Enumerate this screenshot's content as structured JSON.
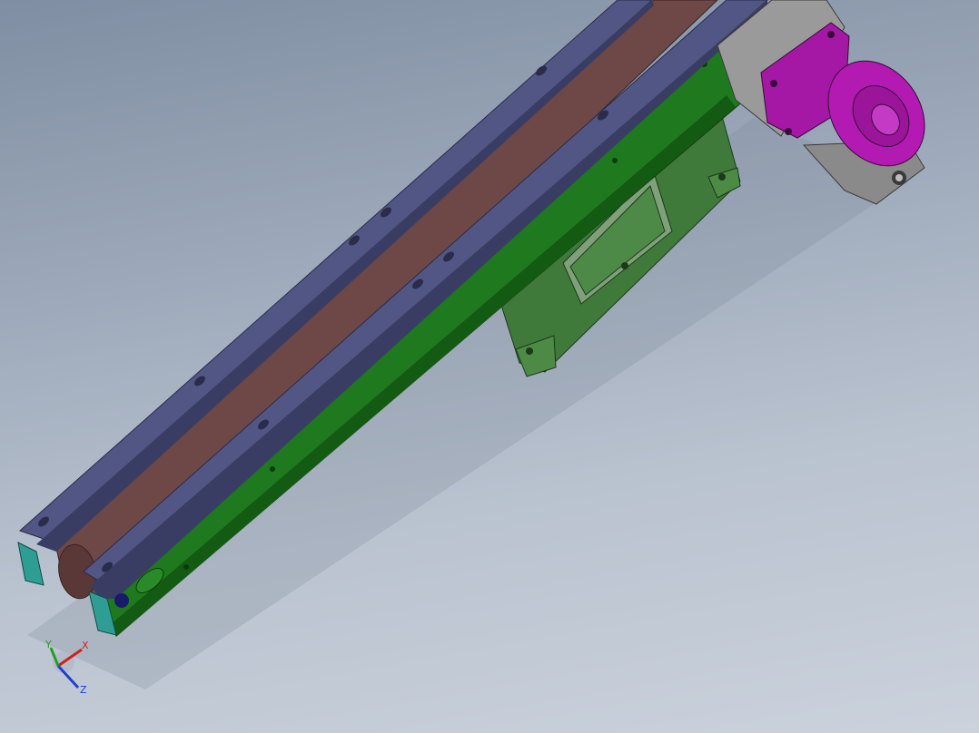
{
  "viewport": {
    "background_top": "#7f8ea2",
    "background_bottom": "#cbd2dc"
  },
  "model": {
    "parts": [
      "conveyor-belt",
      "side-rail-left",
      "side-rail-right",
      "frame",
      "support-bracket",
      "gear-motor",
      "gearbox",
      "end-cap"
    ],
    "colors": {
      "belt": "#6e4747",
      "rail": "#525684",
      "rail_dark": "#3a3d63",
      "frame": "#1f7a1f",
      "frame_dark": "#135a13",
      "bracket": "#3f7a3a",
      "motor": "#b21ab2",
      "gearbox": "#9a9a9a",
      "end_cap": "#2e9e94"
    }
  },
  "triad": {
    "x_label": "X",
    "y_label": "Y",
    "z_label": "Z",
    "x_color": "#d02020",
    "y_color": "#20a020",
    "z_color": "#2040d0"
  }
}
